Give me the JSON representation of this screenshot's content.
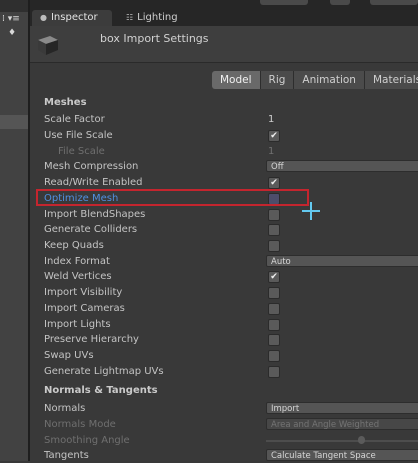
{
  "tabs": {
    "inspector": "Inspector",
    "lighting": "Lighting"
  },
  "left_strip": {
    "icons_text": "⁞ ▾≡",
    "tag_icon": "tag-icon"
  },
  "header": {
    "title": "box Import Settings"
  },
  "import_tabs": [
    "Model",
    "Rig",
    "Animation",
    "Materials"
  ],
  "meshes": {
    "heading": "Meshes",
    "scale_factor": {
      "label": "Scale Factor",
      "value": "1"
    },
    "use_file_scale": {
      "label": "Use File Scale",
      "checked": true
    },
    "file_scale": {
      "label": "File Scale",
      "value": "1"
    },
    "mesh_compression": {
      "label": "Mesh Compression",
      "value": "Off"
    },
    "read_write_enabled": {
      "label": "Read/Write Enabled",
      "checked": true
    },
    "optimize_mesh": {
      "label": "Optimize Mesh",
      "checked": false
    },
    "import_blendshapes": {
      "label": "Import BlendShapes",
      "checked": false
    },
    "generate_colliders": {
      "label": "Generate Colliders",
      "checked": false
    },
    "keep_quads": {
      "label": "Keep Quads",
      "checked": false
    },
    "index_format": {
      "label": "Index Format",
      "value": "Auto"
    },
    "weld_vertices": {
      "label": "Weld Vertices",
      "checked": true
    },
    "import_visibility": {
      "label": "Import Visibility",
      "checked": false
    },
    "import_cameras": {
      "label": "Import Cameras",
      "checked": false
    },
    "import_lights": {
      "label": "Import Lights",
      "checked": false
    },
    "preserve_hierarchy": {
      "label": "Preserve Hierarchy",
      "checked": false
    },
    "swap_uvs": {
      "label": "Swap UVs",
      "checked": false
    },
    "generate_lightmap_uvs": {
      "label": "Generate Lightmap UVs",
      "checked": false
    }
  },
  "normals_tangents": {
    "heading": "Normals & Tangents",
    "normals": {
      "label": "Normals",
      "value": "Import"
    },
    "normals_mode": {
      "label": "Normals Mode",
      "value": "Area and Angle Weighted"
    },
    "smoothing_angle": {
      "label": "Smoothing Angle"
    },
    "tangents": {
      "label": "Tangents",
      "value": "Calculate Tangent Space"
    }
  },
  "check_glyph": "✔",
  "colors": {
    "highlight_box": "#c4252e",
    "highlight_label": "#4f8fe0",
    "cursor": "#63c9f0"
  }
}
